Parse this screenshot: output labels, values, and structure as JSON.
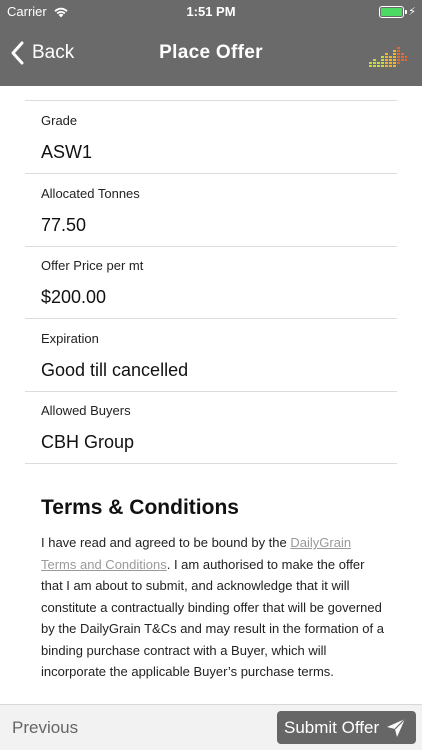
{
  "status_bar": {
    "carrier": "Carrier",
    "time": "1:51 PM"
  },
  "nav": {
    "back_label": "Back",
    "title": "Place Offer"
  },
  "fields": [
    {
      "label": "Grade",
      "value": "ASW1"
    },
    {
      "label": "Allocated Tonnes",
      "value": "77.50"
    },
    {
      "label": "Offer Price per mt",
      "value": "$200.00"
    },
    {
      "label": "Expiration",
      "value": "Good till cancelled"
    },
    {
      "label": "Allowed Buyers",
      "value": "CBH Group"
    }
  ],
  "terms": {
    "title": "Terms & Conditions",
    "intro": "I have read and agreed to be bound by the ",
    "link": "DailyGrain Terms and Conditions",
    "body": ". I am authorised to make the offer that I am about to submit, and acknowledge that it will constitute a contractually binding offer that will be governed by the DailyGrain T&Cs and may result in the formation of a binding purchase contract with a Buyer, which will incorporate the applicable Buyer’s purchase terms."
  },
  "bottom_bar": {
    "previous_label": "Previous",
    "submit_label": "Submit Offer"
  },
  "colors": {
    "header": "#6a6a6a",
    "battery": "#4cd964",
    "submit": "#666666",
    "link": "#9a9a9a"
  }
}
